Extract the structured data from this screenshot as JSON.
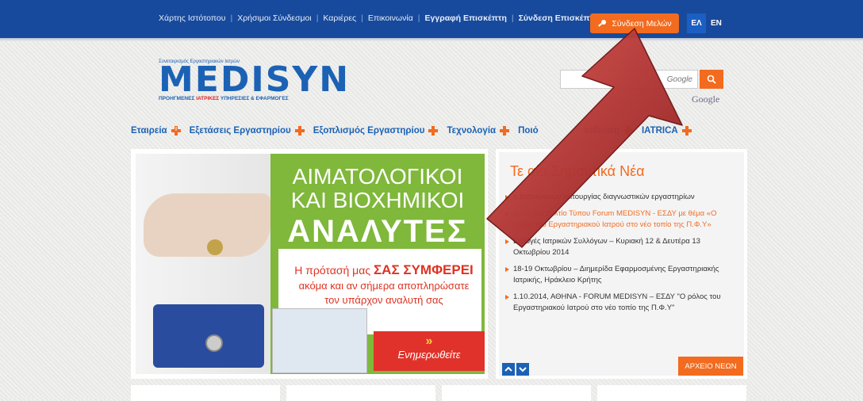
{
  "topbar": {
    "links": [
      "Χάρτης Ιστότοπου",
      "Χρήσιμοι Σύνδεσμοι",
      "Καριέρες",
      "Επικοινωνία",
      "Εγγραφή Επισκέπτη",
      "Σύνδεση Επισκέπτη"
    ],
    "member_login": "Σύνδεση Μελών",
    "lang_el": "ΕΛ",
    "lang_en": "EN"
  },
  "logo": {
    "small": "Συνεταιρισμός Εργαστηριακών Ιατρών",
    "main": "MEDISYN",
    "subtitle_a": "ΠΡΟΗΓΜΕΝΕΣ",
    "subtitle_b": "ΙΑΤΡΙΚΕΣ",
    "subtitle_c": "ΥΠΗΡΕΣΙΕΣ & ΕΦΑΡΜΟΓΕΣ"
  },
  "search": {
    "placeholder": "Google",
    "google_mark": "Google"
  },
  "nav": [
    "Εταιρεία",
    "Εξετάσεις Εργαστηρίου",
    "Εξοπλισμός Εργαστηρίου",
    "Τεχνολογία",
    "Ποιό",
    "αίδευση",
    "IATRICA"
  ],
  "banner": {
    "line1": "ΑΙΜΑΤΟΛΟΓΙΚΟΙ",
    "line2": "ΚΑΙ ΒΙΟΧΗΜΙΚΟΙ",
    "line3": "ΑΝΑΛΥΤΕΣ",
    "offer_a": "Η πρότασή μας",
    "offer_b": "ΣΑΣ ΣΥΜΦΕΡΕΙ",
    "offer_c": "ακόμα και αν σήμερα αποπληρώσατε",
    "offer_d": "τον υπάρχον αναλυτή σας",
    "cta_arrow": "»",
    "cta": "Ενημερωθείτε"
  },
  "news": {
    "title": "Τε        αία Σημαντικά Νέα",
    "items": [
      {
        "text": "          η βεβαιώσεων λειτουργίας διαγνωστικών εργαστηρίων",
        "highlight": false
      },
      {
        "text": "          ώσεις και Δελτίο Τύπου Forum MEDISYN - ΕΣΔΥ με θέμα «Ο ρόλος του Εργαστηριακού Ιατρού στο νέο τοπίο της Π.Φ.Υ»",
        "highlight": true
      },
      {
        "text": "Εκλογές Ιατρικών Συλλόγων – Κυριακή 12 & Δευτέρα 13 Οκτωβρίου 2014",
        "highlight": false
      },
      {
        "text": "18-19 Οκτωβρίου – Διημερίδα Εφαρμοσμένης Εργαστηριακής Ιατρικής, Ηράκλειο Κρήτης",
        "highlight": false
      },
      {
        "text": "1.10.2014, ΑΘΗΝΑ - FORUM MEDISYN – ΕΣΔΥ \"Ο ρόλος του Εργαστηριακού Ιατρού στο νέο τοπίο της Π.Φ.Υ\"",
        "highlight": false
      }
    ],
    "archive": "ΑΡΧΕΙΟ ΝΕΩΝ"
  },
  "colors": {
    "topbar": "#174a9c",
    "accent": "#f26b1f",
    "brand": "#1b62b5",
    "banner_green": "#7fb83a",
    "arrow_red": "#b3282a"
  }
}
